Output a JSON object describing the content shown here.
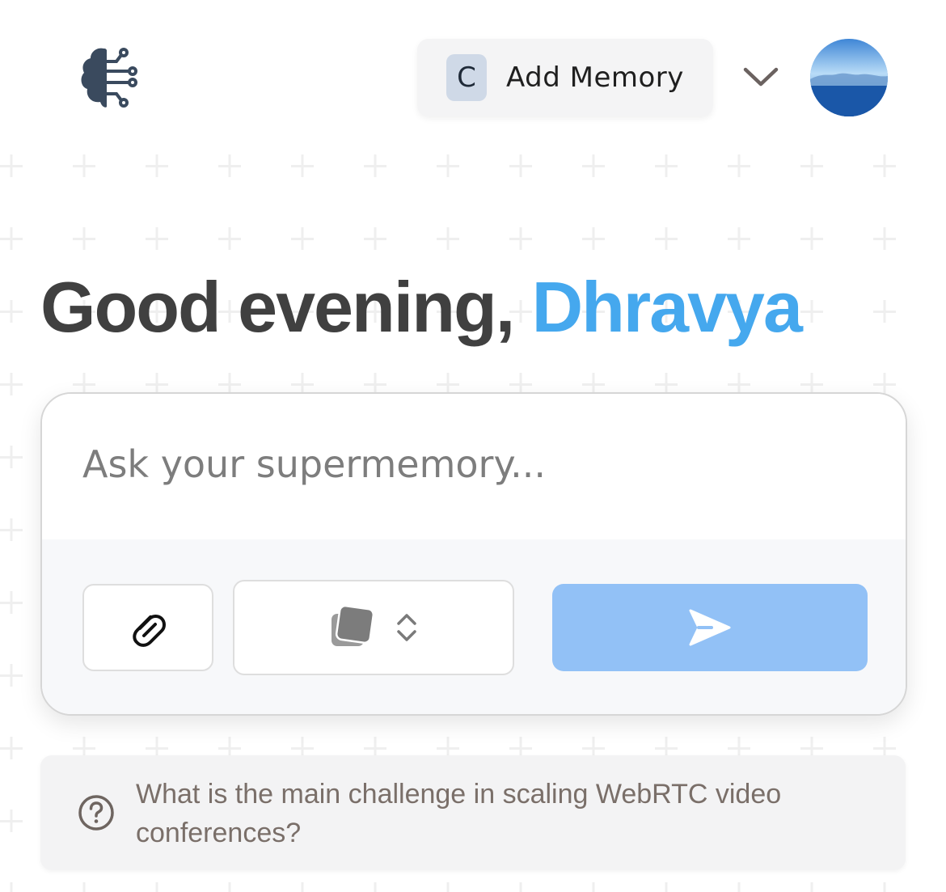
{
  "header": {
    "logo_icon": "brain-circuit-icon",
    "add_memory": {
      "badge": "C",
      "label": "Add Memory"
    },
    "dropdown_icon": "chevron-down-icon",
    "avatar_icon": "avatar"
  },
  "greeting": {
    "prefix": "Good evening,",
    "name": "Dhravya"
  },
  "chat": {
    "placeholder": "Ask your supermemory...",
    "attach_icon": "paperclip-icon",
    "space_icon": "stacked-cards-icon",
    "space_selector_icon": "chevron-up-down-icon",
    "send_icon": "send-icon"
  },
  "suggestion": {
    "icon": "question-circle-icon",
    "text": "What is the main challenge in scaling WebRTC video conferences?"
  },
  "colors": {
    "accent": "#45a8ee",
    "send_button": "#92c1f6",
    "heading": "#404040"
  }
}
